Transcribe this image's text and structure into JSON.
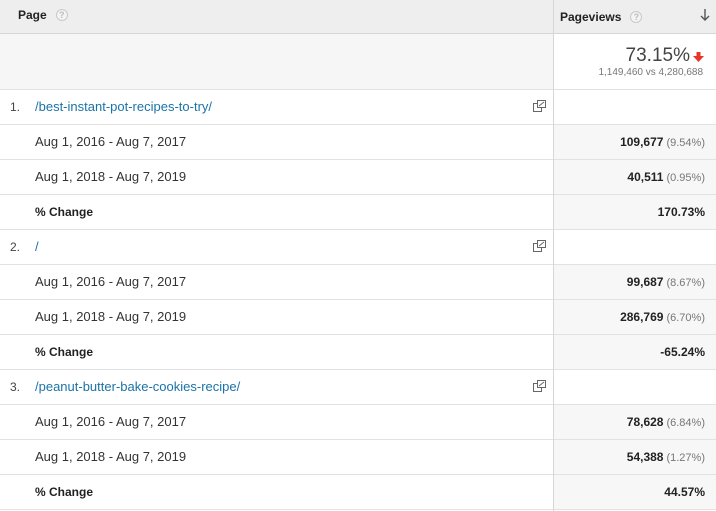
{
  "header": {
    "page_label": "Page",
    "pageviews_label": "Pageviews",
    "help_glyph": "?"
  },
  "summary": {
    "change_pct": "73.15%",
    "comparison": "1,149,460 vs 4,280,688",
    "trend": "down",
    "trend_color": "#e8332a"
  },
  "rows": [
    {
      "index": "1.",
      "page": "/best-instant-pot-recipes-to-try/",
      "period1": {
        "label": "Aug 1, 2016 - Aug 7, 2017",
        "value": "109,677",
        "pct": "(9.54%)"
      },
      "period2": {
        "label": "Aug 1, 2018 - Aug 7, 2019",
        "value": "40,511",
        "pct": "(0.95%)"
      },
      "change": {
        "label": "% Change",
        "value": "170.73%"
      }
    },
    {
      "index": "2.",
      "page": "/",
      "period1": {
        "label": "Aug 1, 2016 - Aug 7, 2017",
        "value": "99,687",
        "pct": "(8.67%)"
      },
      "period2": {
        "label": "Aug 1, 2018 - Aug 7, 2019",
        "value": "286,769",
        "pct": "(6.70%)"
      },
      "change": {
        "label": "% Change",
        "value": "-65.24%"
      }
    },
    {
      "index": "3.",
      "page": "/peanut-butter-bake-cookies-recipe/",
      "period1": {
        "label": "Aug 1, 2016 - Aug 7, 2017",
        "value": "78,628",
        "pct": "(6.84%)"
      },
      "period2": {
        "label": "Aug 1, 2018 - Aug 7, 2019",
        "value": "54,388",
        "pct": "(1.27%)"
      },
      "change": {
        "label": "% Change",
        "value": "44.57%"
      }
    }
  ],
  "colors": {
    "link": "#1a73a8",
    "header_bg": "#eeeeee",
    "down_arrow": "#e8332a"
  }
}
